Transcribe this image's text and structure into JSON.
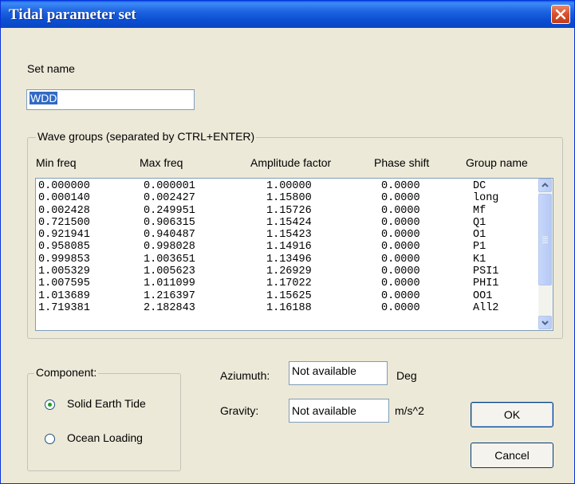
{
  "dialog": {
    "title": "Tidal parameter set",
    "set_name_label": "Set name",
    "set_name_value": "WDD",
    "wave_groups_legend": "Wave groups (separated by CTRL+ENTER)",
    "columns": [
      "Min freq",
      "Max freq",
      "Amplitude factor",
      "Phase shift",
      "Group name"
    ],
    "rows": [
      [
        "0.000000",
        "0.000001",
        "1.00000",
        "0.0000",
        "DC"
      ],
      [
        "0.000140",
        "0.002427",
        "1.15800",
        "0.0000",
        "long"
      ],
      [
        "0.002428",
        "0.249951",
        "1.15726",
        "0.0000",
        "Mf"
      ],
      [
        "0.721500",
        "0.906315",
        "1.15424",
        "0.0000",
        "Q1"
      ],
      [
        "0.921941",
        "0.940487",
        "1.15423",
        "0.0000",
        "O1"
      ],
      [
        "0.958085",
        "0.998028",
        "1.14916",
        "0.0000",
        "P1"
      ],
      [
        "0.999853",
        "1.003651",
        "1.13496",
        "0.0000",
        "K1"
      ],
      [
        "1.005329",
        "1.005623",
        "1.26929",
        "0.0000",
        "PSI1"
      ],
      [
        "1.007595",
        "1.011099",
        "1.17022",
        "0.0000",
        "PHI1"
      ],
      [
        "1.013689",
        "1.216397",
        "1.15625",
        "0.0000",
        "OO1"
      ],
      [
        "1.719381",
        "2.182843",
        "1.16188",
        "0.0000",
        "All2"
      ]
    ],
    "component_legend": "Component:",
    "component_options": [
      "Solid Earth Tide",
      "Ocean Loading"
    ],
    "component_selected": "Solid Earth Tide",
    "azimuth_label": "Aziumuth:",
    "azimuth_value": "Not available",
    "azimuth_unit": "Deg",
    "gravity_label": "Gravity:",
    "gravity_value": "Not available",
    "gravity_unit": "m/s^2",
    "ok_label": "OK",
    "cancel_label": "Cancel"
  }
}
